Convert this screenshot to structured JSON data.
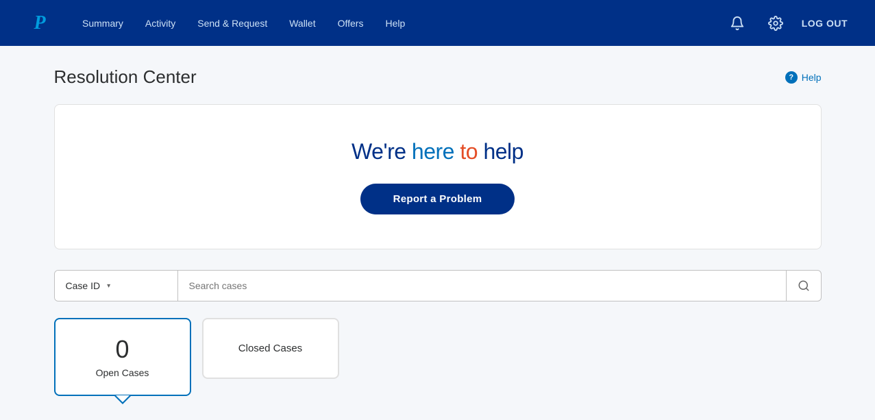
{
  "navbar": {
    "logo_letter": "P",
    "links": [
      {
        "id": "summary",
        "label": "Summary"
      },
      {
        "id": "activity",
        "label": "Activity"
      },
      {
        "id": "send-request",
        "label": "Send & Request"
      },
      {
        "id": "wallet",
        "label": "Wallet"
      },
      {
        "id": "offers",
        "label": "Offers"
      },
      {
        "id": "help",
        "label": "Help"
      }
    ],
    "logout_label": "LOG OUT",
    "bell_icon": "🔔",
    "gear_icon": "⚙"
  },
  "page": {
    "title": "Resolution Center",
    "help_label": "Help",
    "help_icon": "?"
  },
  "hero": {
    "headline_part1": "We're ",
    "headline_part2": "here to help",
    "report_button_label": "Report a Problem"
  },
  "search": {
    "dropdown_label": "Case ID",
    "placeholder": "Search cases",
    "chevron": "▾"
  },
  "tabs": [
    {
      "id": "open-cases",
      "count": "0",
      "label": "Open Cases",
      "active": true
    },
    {
      "id": "closed-cases",
      "label_only": "Closed Cases",
      "active": false
    }
  ]
}
